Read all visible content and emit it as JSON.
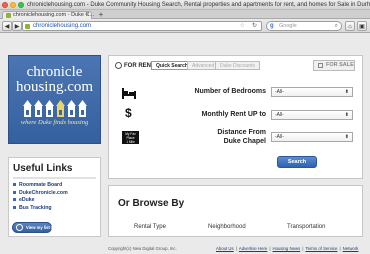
{
  "window": {
    "title": "chroniclehousing.com - Duke Community Housing Search, Rental properties and apartments for rent, and homes for Sale in Durham, NC near Duke University"
  },
  "tab": {
    "label": "chroniclehousing.com - Duke C...",
    "close": "×"
  },
  "browser": {
    "url": "chroniclehousing.com",
    "search_engine": "Google",
    "new_tab": "+"
  },
  "logo": {
    "line1": "chronicle",
    "line2": "housing.com",
    "tagline": "where Duke finds housing"
  },
  "search": {
    "for_rent": "FOR RENT",
    "tabs": [
      "Quick Search",
      "Advanced",
      "Duke Discounts"
    ],
    "for_sale": "FOR SALE",
    "fields": [
      {
        "label": "Number of Bedrooms",
        "value": "-All-"
      },
      {
        "label": "Monthly Rent UP to",
        "value": "-All-"
      },
      {
        "label": "Distance From Duke Chapel",
        "value": "-All-"
      }
    ],
    "distance_icon_text": [
      "My Fav",
      "Place",
      "1 Mile"
    ],
    "search_button": "Search"
  },
  "useful_links": {
    "title": "Useful Links",
    "items": [
      "Roommate Board",
      "DukeChronicle.com",
      "eDuke",
      "Bus Tracking"
    ],
    "favorites_button": "View my list (0)"
  },
  "browse": {
    "title": "Or Browse By",
    "columns": [
      "Rental Type",
      "Neighborhood",
      "Transportation"
    ]
  },
  "footer": {
    "copyright": "Copyright(c) New Digital Group, Inc.",
    "links": [
      "About Us",
      "Advertise Here",
      "Housing News",
      "Terms of Service",
      "Network"
    ]
  },
  "colors": {
    "logo_blue": "#3d68a8",
    "link_blue": "#1e3d7a",
    "button_blue": "#2f62b0"
  }
}
